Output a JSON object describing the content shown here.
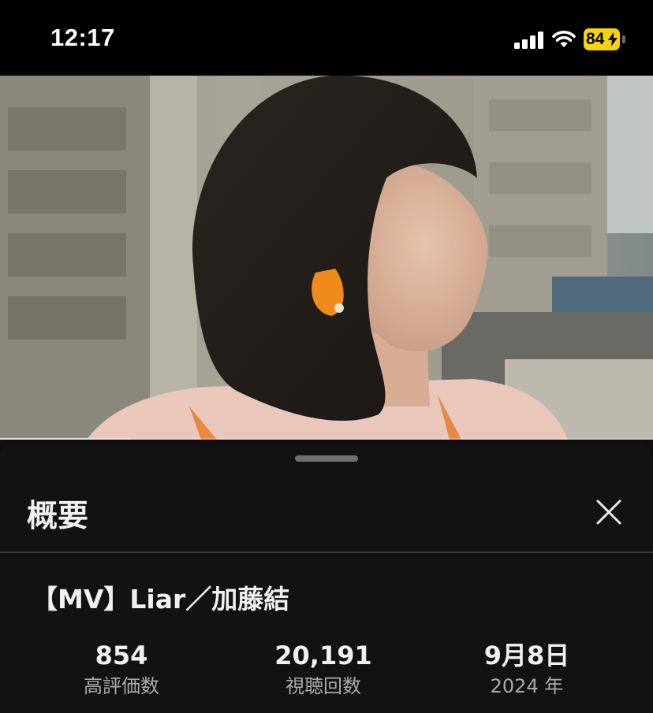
{
  "status_bar": {
    "time": "12:17",
    "battery_level": "84",
    "icons": [
      "signal-icon",
      "wifi-icon",
      "battery-icon",
      "charging-bolt-icon"
    ]
  },
  "player": {
    "progress_fraction": 0.2,
    "thumbnail": "Music video frame: woman with short dark bob and orange earring, city buildings behind"
  },
  "description_panel": {
    "title": "概要",
    "close_icon": "close-icon",
    "video_title": "【MV】Liar／加藤結",
    "stats": [
      {
        "value": "854",
        "label": "高評価数"
      },
      {
        "value": "20,191",
        "label": "視聴回数"
      },
      {
        "value": "9月8日",
        "label": "2024 年"
      }
    ]
  },
  "colors": {
    "background": "#0f0f0f",
    "sheet": "#121212",
    "battery": "#f5d30f",
    "secondary_text": "#aaaaaa"
  }
}
